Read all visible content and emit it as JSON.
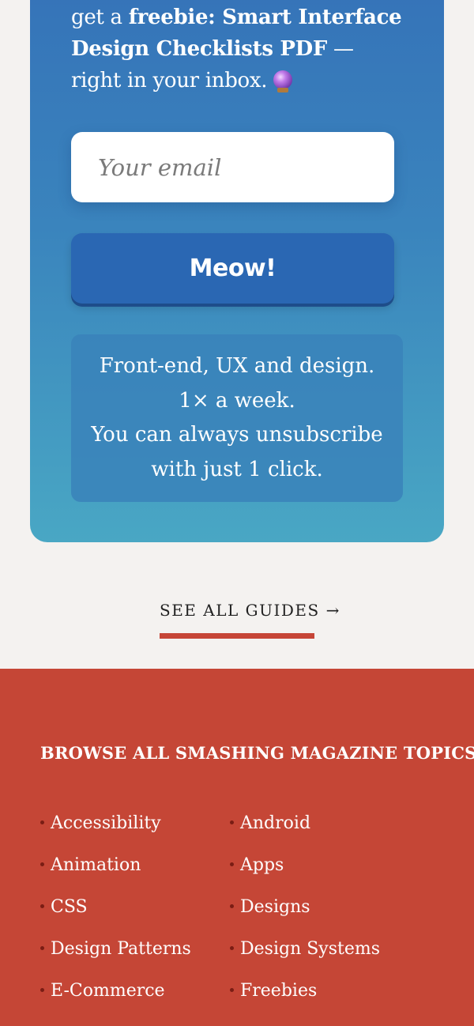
{
  "newsletter": {
    "intro_prefix": "get a ",
    "intro_bold": "freebie: Smart Interface Design Checklists PDF",
    "intro_suffix": " — right in your inbox.",
    "crystal_ball_icon": "crystal-ball-icon",
    "email_placeholder": "Your email",
    "submit_label": "Meow!",
    "info_lines": [
      "Front-end, UX and design.",
      "1× a week.",
      "You can always unsubscribe",
      "with just 1 click."
    ]
  },
  "see_all": {
    "label": "SEE ALL GUIDES",
    "arrow": "→"
  },
  "topics": {
    "heading": "BROWSE ALL SMASHING MAGAZINE TOPICS",
    "left": [
      "Accessibility",
      "Animation",
      "CSS",
      "Design Patterns",
      "E-Commerce"
    ],
    "right": [
      "Android",
      "Apps",
      "Designs",
      "Design Systems",
      "Freebies"
    ]
  },
  "colors": {
    "card_top": "#3572b8",
    "card_bottom": "#49a7c4",
    "button": "#2a67b3",
    "accent_red": "#c54636",
    "page_bg": "#f4f2f0"
  }
}
